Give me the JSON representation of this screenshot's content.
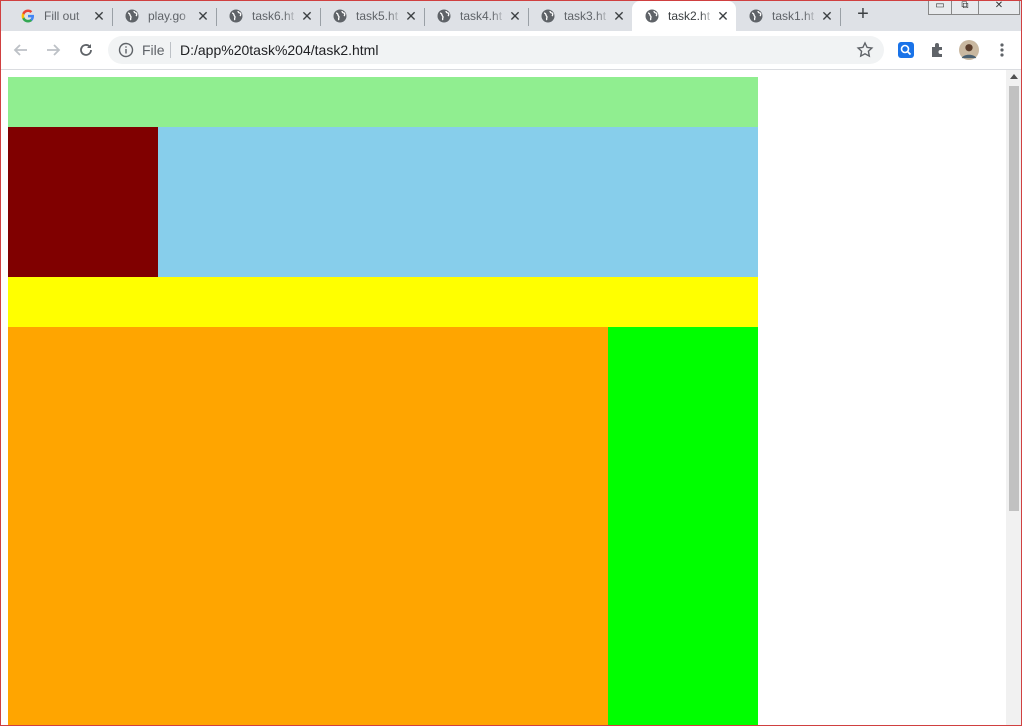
{
  "browser": {
    "tabs": [
      {
        "title": "Fill out",
        "favicon": "google-icon",
        "active": false
      },
      {
        "title": "play.go",
        "favicon": "globe-icon",
        "active": false
      },
      {
        "title": "task6.ht",
        "favicon": "globe-icon",
        "active": false
      },
      {
        "title": "task5.ht",
        "favicon": "globe-icon",
        "active": false
      },
      {
        "title": "task4.ht",
        "favicon": "globe-icon",
        "active": false
      },
      {
        "title": "task3.ht",
        "favicon": "globe-icon",
        "active": false
      },
      {
        "title": "task2.ht",
        "favicon": "globe-icon",
        "active": true
      },
      {
        "title": "task1.ht",
        "favicon": "globe-icon",
        "active": false
      }
    ],
    "omnibox": {
      "scheme_label": "File",
      "url": "D:/app%20task%204/task2.html"
    }
  },
  "page": {
    "colors": {
      "top_band": "#90ee90",
      "middle_band": "#87ceeb",
      "maroon_box": "#800000",
      "yellow_band": "#ffff00",
      "orange_area": "#ffa500",
      "lime_area": "#00ff00"
    }
  }
}
